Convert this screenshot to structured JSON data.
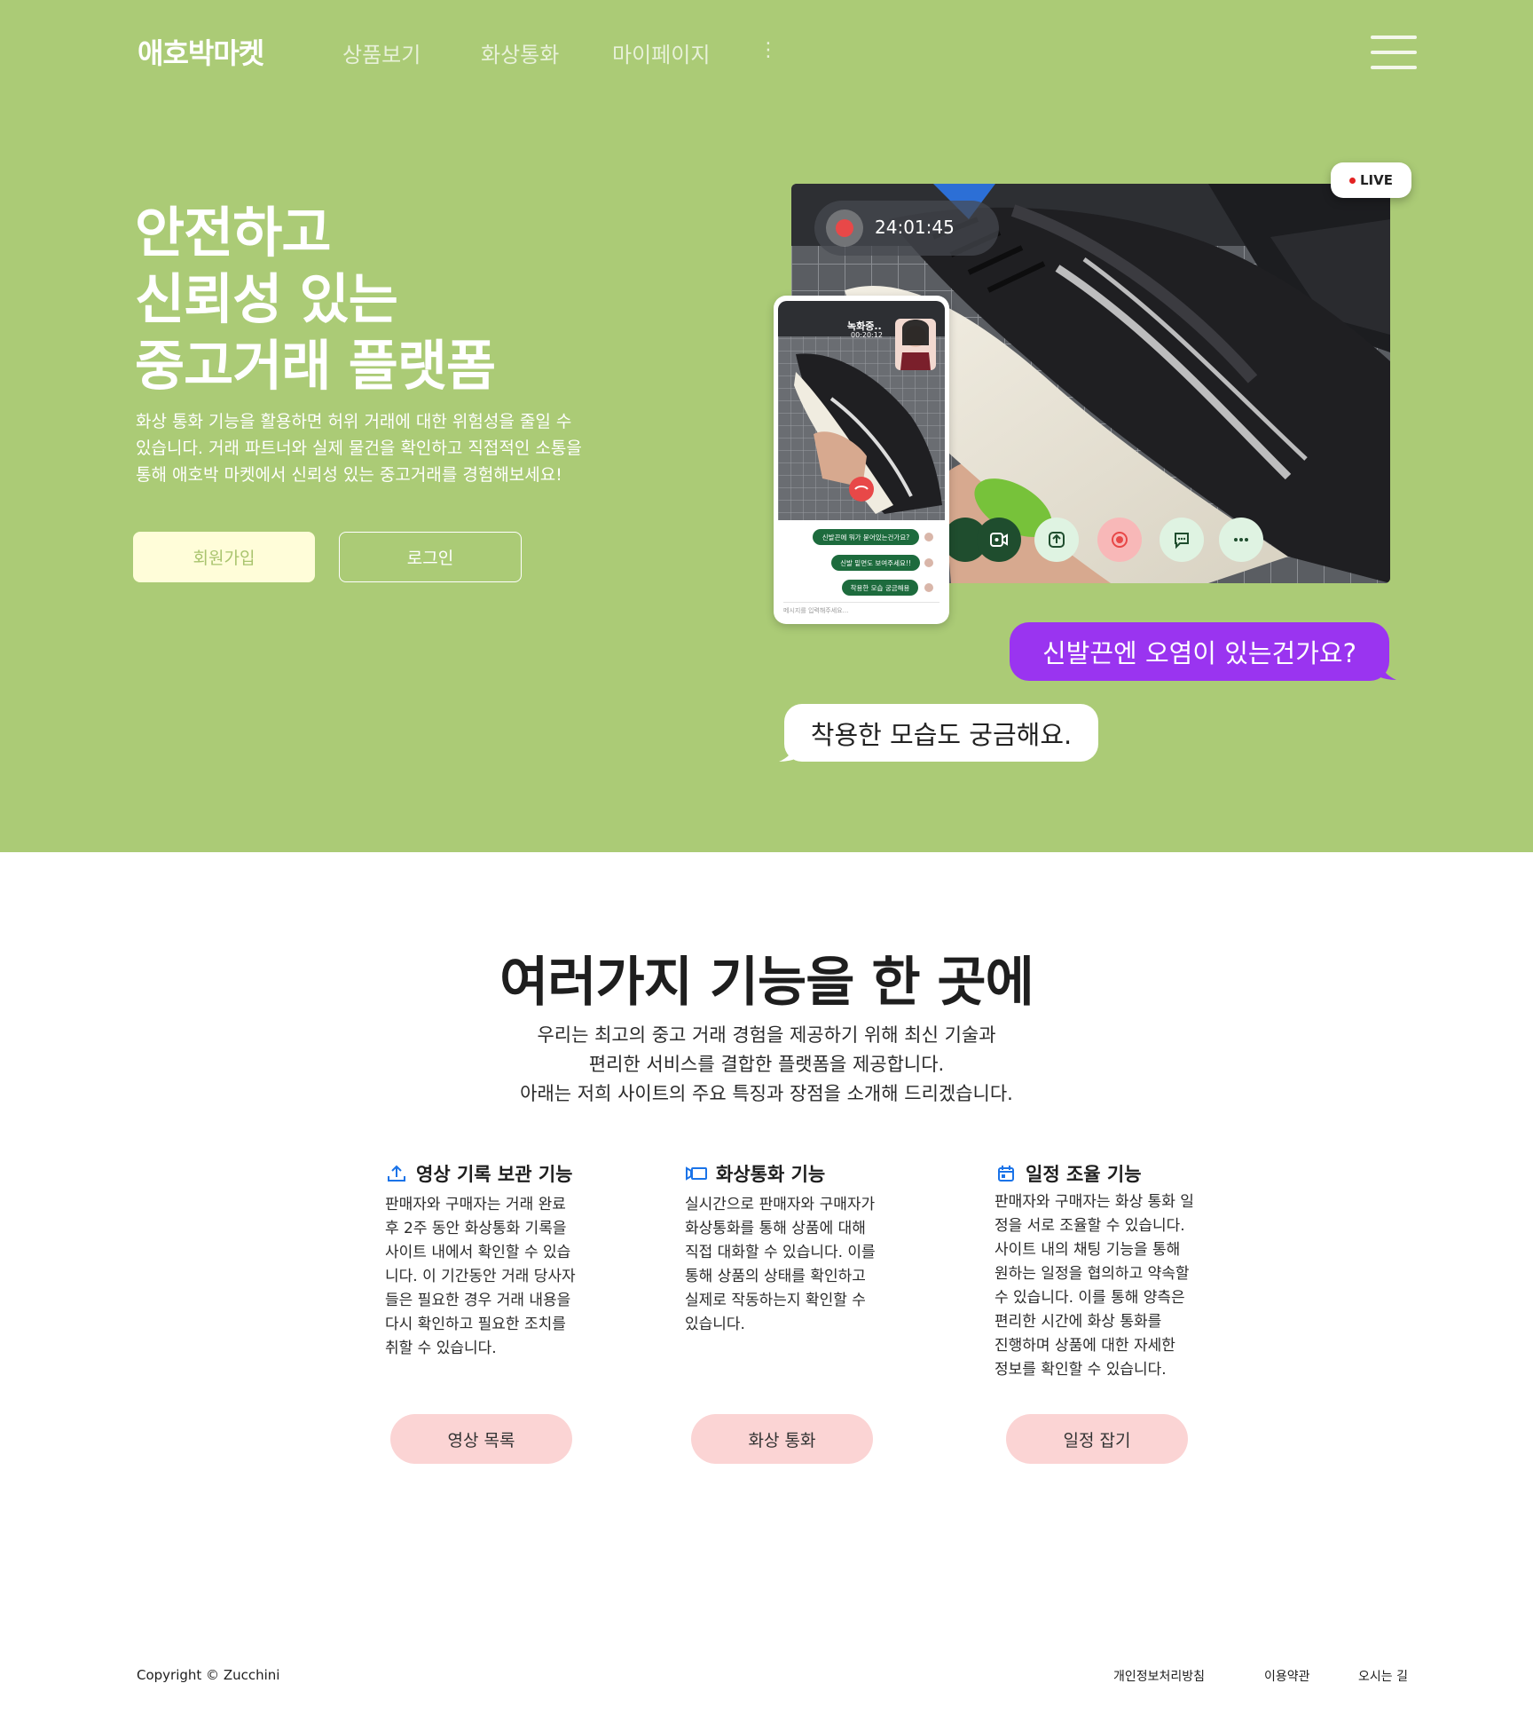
{
  "header": {
    "brand": "애호박마켓",
    "nav": [
      "상품보기",
      "화상통화",
      "마이페이지"
    ],
    "nav_more": "⋮",
    "menu_icon": "hamburger-icon"
  },
  "hero": {
    "title_lines": [
      "안전하고",
      "신뢰성 있는",
      "중고거래 플랫폼"
    ],
    "desc_lines": [
      "화상 통화 기능을 활용하면 허위 거래에 대한 위험성을 줄일 수",
      "있습니다. 거래 파트너와 실제 물건을 확인하고 직접적인 소통을",
      "통해 애호박 마켓에서 신뢰성 있는 중고거래를 경험해보세요!"
    ],
    "signup_label": "회원가입",
    "login_label": "로그인"
  },
  "video_call": {
    "timer": "24:01:45",
    "live_label": "LIVE",
    "controls": [
      "camera-icon",
      "upload-icon",
      "record-icon",
      "chat-icon",
      "more-icon"
    ],
    "phone": {
      "status": "녹화중..",
      "time": "00:20:12",
      "messages": [
        "신발끈에 뭐가 묻어있는건가요?",
        "신발 밑면도 보여주세요!!",
        "착용한 모습 궁금해용"
      ],
      "input_placeholder": "메시지를 입력해주세요..."
    },
    "bubble_question": "신발끈엔 오염이 있는건가요?",
    "bubble_request": "착용한 모습도 궁금해요."
  },
  "features": {
    "title": "여러가지 기능을 한 곳에",
    "desc_lines": [
      "우리는 최고의 중고 거래 경험을 제공하기 위해 최신 기술과",
      "편리한 서비스를 결합한 플랫폼을 제공합니다.",
      "아래는 저희 사이트의 주요 특징과 장점을 소개해 드리겠습니다."
    ],
    "items": [
      {
        "icon": "upload-icon",
        "title": "영상 기록 보관 기능",
        "lines": [
          "판매자와 구매자는 거래 완료",
          "후 2주 동안 화상통화 기록을",
          "사이트 내에서 확인할 수 있습",
          "니다. 이 기간동안 거래 당사자",
          "들은 필요한 경우 거래 내용을",
          "다시 확인하고 필요한 조치를",
          "취할 수 있습니다."
        ],
        "button": "영상 목록"
      },
      {
        "icon": "video-icon",
        "title": "화상통화 기능",
        "lines": [
          "실시간으로 판매자와 구매자가",
          "화상통화를 통해 상품에 대해",
          "직접 대화할 수 있습니다. 이를",
          "통해 상품의 상태를 확인하고",
          "실제로 작동하는지 확인할 수",
          "있습니다."
        ],
        "button": "화상 통화"
      },
      {
        "icon": "calendar-icon",
        "title": "일정 조율 기능",
        "lines": [
          "판매자와 구매자는 화상 통화 일",
          "정을 서로 조율할 수 있습니다.",
          "사이트 내의 채팅 기능을 통해",
          "원하는 일정을 협의하고 약속할",
          "수 있습니다. 이를 통해 양측은",
          "편리한 시간에 화상 통화를",
          "진행하며 상품에 대한 자세한",
          "정보를 확인할 수 있습니다."
        ],
        "button": "일정 잡기"
      }
    ]
  },
  "footer": {
    "copyright": "Copyright © Zucchini",
    "links": [
      "개인정보처리방침",
      "이용약관",
      "오시는 길"
    ]
  },
  "colors": {
    "hero_bg": "#abcb76",
    "signup_bg": "#fffdd9",
    "bubble_purple": "#9a34f0",
    "pill_button": "#fbd4d4",
    "feature_icon": "#1a73e8"
  }
}
